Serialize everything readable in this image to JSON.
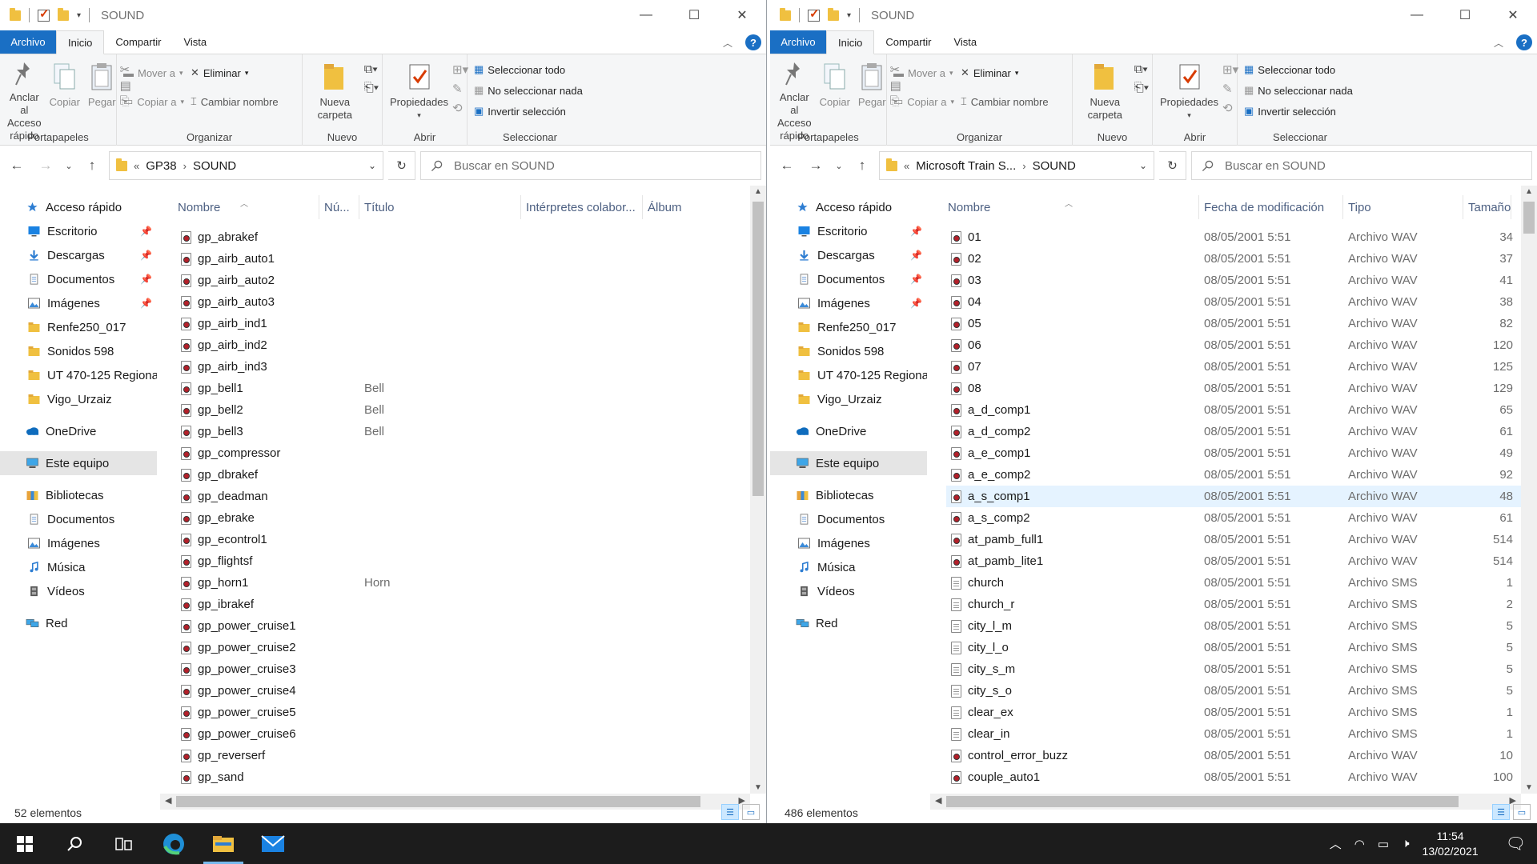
{
  "windows": [
    {
      "title": "SOUND",
      "tabs": {
        "file": "Archivo",
        "home": "Inicio",
        "share": "Compartir",
        "view": "Vista"
      },
      "ribbon": {
        "pin": "Anclar al Acceso rápido",
        "copy": "Copiar",
        "paste": "Pegar",
        "clipboard_group": "Portapapeles",
        "move_to": "Mover a",
        "copy_to": "Copiar a",
        "delete": "Eliminar",
        "rename": "Cambiar nombre",
        "organize_group": "Organizar",
        "new_folder": "Nueva carpeta",
        "new_group": "Nuevo",
        "properties": "Propiedades",
        "open_group": "Abrir",
        "select_all": "Seleccionar todo",
        "select_none": "No seleccionar nada",
        "invert": "Invertir selección",
        "select_group": "Seleccionar"
      },
      "path": [
        "GP38",
        "SOUND"
      ],
      "search_placeholder": "Buscar en SOUND",
      "nav": [
        {
          "label": "Acceso rápido",
          "icon": "star-icon",
          "top": true
        },
        {
          "label": "Escritorio",
          "icon": "desktop-icon",
          "pin": true
        },
        {
          "label": "Descargas",
          "icon": "download-icon",
          "pin": true
        },
        {
          "label": "Documentos",
          "icon": "document-icon",
          "pin": true
        },
        {
          "label": "Imágenes",
          "icon": "pictures-icon",
          "pin": true
        },
        {
          "label": "Renfe250_017",
          "icon": "folder-icon"
        },
        {
          "label": "Sonidos 598",
          "icon": "folder-icon"
        },
        {
          "label": "UT 470-125 Regional",
          "icon": "folder-icon"
        },
        {
          "label": "Vigo_Urzaiz",
          "icon": "folder-icon"
        },
        {
          "label": "OneDrive",
          "icon": "cloud-icon",
          "top": true,
          "gap": true
        },
        {
          "label": "Este equipo",
          "icon": "computer-icon",
          "top": true,
          "gap": true,
          "sel": true
        },
        {
          "label": "Bibliotecas",
          "icon": "libraries-icon",
          "top": true,
          "gap": true
        },
        {
          "label": "Documentos",
          "icon": "document-icon"
        },
        {
          "label": "Imágenes",
          "icon": "pictures-icon"
        },
        {
          "label": "Música",
          "icon": "music-icon"
        },
        {
          "label": "Vídeos",
          "icon": "video-icon"
        },
        {
          "label": "Red",
          "icon": "network-icon",
          "top": true,
          "gap": true
        }
      ],
      "columns": [
        "Nombre",
        "Nú...",
        "Título",
        "Intérpretes colabor...",
        "Álbum"
      ],
      "files": [
        {
          "name": "gp_abrakef",
          "title": ""
        },
        {
          "name": "gp_airb_auto1",
          "title": ""
        },
        {
          "name": "gp_airb_auto2",
          "title": ""
        },
        {
          "name": "gp_airb_auto3",
          "title": ""
        },
        {
          "name": "gp_airb_ind1",
          "title": ""
        },
        {
          "name": "gp_airb_ind2",
          "title": ""
        },
        {
          "name": "gp_airb_ind3",
          "title": ""
        },
        {
          "name": "gp_bell1",
          "title": "Bell"
        },
        {
          "name": "gp_bell2",
          "title": "Bell"
        },
        {
          "name": "gp_bell3",
          "title": "Bell"
        },
        {
          "name": "gp_compressor",
          "title": ""
        },
        {
          "name": "gp_dbrakef",
          "title": ""
        },
        {
          "name": "gp_deadman",
          "title": ""
        },
        {
          "name": "gp_ebrake",
          "title": ""
        },
        {
          "name": "gp_econtrol1",
          "title": ""
        },
        {
          "name": "gp_flightsf",
          "title": ""
        },
        {
          "name": "gp_horn1",
          "title": "Horn"
        },
        {
          "name": "gp_ibrakef",
          "title": ""
        },
        {
          "name": "gp_power_cruise1",
          "title": ""
        },
        {
          "name": "gp_power_cruise2",
          "title": ""
        },
        {
          "name": "gp_power_cruise3",
          "title": ""
        },
        {
          "name": "gp_power_cruise4",
          "title": ""
        },
        {
          "name": "gp_power_cruise5",
          "title": ""
        },
        {
          "name": "gp_power_cruise6",
          "title": ""
        },
        {
          "name": "gp_reverserf",
          "title": ""
        },
        {
          "name": "gp_sand",
          "title": ""
        }
      ],
      "status": "52 elementos"
    },
    {
      "title": "SOUND",
      "tabs": {
        "file": "Archivo",
        "home": "Inicio",
        "share": "Compartir",
        "view": "Vista"
      },
      "ribbon": {
        "pin": "Anclar al Acceso rápido",
        "copy": "Copiar",
        "paste": "Pegar",
        "clipboard_group": "Portapapeles",
        "move_to": "Mover a",
        "copy_to": "Copiar a",
        "delete": "Eliminar",
        "rename": "Cambiar nombre",
        "organize_group": "Organizar",
        "new_folder": "Nueva carpeta",
        "new_group": "Nuevo",
        "properties": "Propiedades",
        "open_group": "Abrir",
        "select_all": "Seleccionar todo",
        "select_none": "No seleccionar nada",
        "invert": "Invertir selección",
        "select_group": "Seleccionar"
      },
      "path": [
        "Microsoft Train S...",
        "SOUND"
      ],
      "search_placeholder": "Buscar en SOUND",
      "nav": [
        {
          "label": "Acceso rápido",
          "icon": "star-icon",
          "top": true
        },
        {
          "label": "Escritorio",
          "icon": "desktop-icon",
          "pin": true
        },
        {
          "label": "Descargas",
          "icon": "download-icon",
          "pin": true
        },
        {
          "label": "Documentos",
          "icon": "document-icon",
          "pin": true
        },
        {
          "label": "Imágenes",
          "icon": "pictures-icon",
          "pin": true
        },
        {
          "label": "Renfe250_017",
          "icon": "folder-icon"
        },
        {
          "label": "Sonidos 598",
          "icon": "folder-icon"
        },
        {
          "label": "UT 470-125 Regional",
          "icon": "folder-icon"
        },
        {
          "label": "Vigo_Urzaiz",
          "icon": "folder-icon"
        },
        {
          "label": "OneDrive",
          "icon": "cloud-icon",
          "top": true,
          "gap": true
        },
        {
          "label": "Este equipo",
          "icon": "computer-icon",
          "top": true,
          "gap": true,
          "sel": true
        },
        {
          "label": "Bibliotecas",
          "icon": "libraries-icon",
          "top": true,
          "gap": true
        },
        {
          "label": "Documentos",
          "icon": "document-icon"
        },
        {
          "label": "Imágenes",
          "icon": "pictures-icon"
        },
        {
          "label": "Música",
          "icon": "music-icon"
        },
        {
          "label": "Vídeos",
          "icon": "video-icon"
        },
        {
          "label": "Red",
          "icon": "network-icon",
          "top": true,
          "gap": true
        }
      ],
      "columns": [
        "Nombre",
        "Fecha de modificación",
        "Tipo",
        "Tamaño"
      ],
      "files": [
        {
          "name": "01",
          "date": "08/05/2001 5:51",
          "type": "Archivo WAV",
          "size": "34",
          "kind": "wav"
        },
        {
          "name": "02",
          "date": "08/05/2001 5:51",
          "type": "Archivo WAV",
          "size": "37",
          "kind": "wav"
        },
        {
          "name": "03",
          "date": "08/05/2001 5:51",
          "type": "Archivo WAV",
          "size": "41",
          "kind": "wav"
        },
        {
          "name": "04",
          "date": "08/05/2001 5:51",
          "type": "Archivo WAV",
          "size": "38",
          "kind": "wav"
        },
        {
          "name": "05",
          "date": "08/05/2001 5:51",
          "type": "Archivo WAV",
          "size": "82",
          "kind": "wav"
        },
        {
          "name": "06",
          "date": "08/05/2001 5:51",
          "type": "Archivo WAV",
          "size": "120",
          "kind": "wav"
        },
        {
          "name": "07",
          "date": "08/05/2001 5:51",
          "type": "Archivo WAV",
          "size": "125",
          "kind": "wav"
        },
        {
          "name": "08",
          "date": "08/05/2001 5:51",
          "type": "Archivo WAV",
          "size": "129",
          "kind": "wav"
        },
        {
          "name": "a_d_comp1",
          "date": "08/05/2001 5:51",
          "type": "Archivo WAV",
          "size": "65",
          "kind": "wav"
        },
        {
          "name": "a_d_comp2",
          "date": "08/05/2001 5:51",
          "type": "Archivo WAV",
          "size": "61",
          "kind": "wav"
        },
        {
          "name": "a_e_comp1",
          "date": "08/05/2001 5:51",
          "type": "Archivo WAV",
          "size": "49",
          "kind": "wav"
        },
        {
          "name": "a_e_comp2",
          "date": "08/05/2001 5:51",
          "type": "Archivo WAV",
          "size": "92",
          "kind": "wav"
        },
        {
          "name": "a_s_comp1",
          "date": "08/05/2001 5:51",
          "type": "Archivo WAV",
          "size": "48",
          "kind": "wav",
          "hl": true
        },
        {
          "name": "a_s_comp2",
          "date": "08/05/2001 5:51",
          "type": "Archivo WAV",
          "size": "61",
          "kind": "wav"
        },
        {
          "name": "at_pamb_full1",
          "date": "08/05/2001 5:51",
          "type": "Archivo WAV",
          "size": "514",
          "kind": "wav"
        },
        {
          "name": "at_pamb_lite1",
          "date": "08/05/2001 5:51",
          "type": "Archivo WAV",
          "size": "514",
          "kind": "wav"
        },
        {
          "name": "church",
          "date": "08/05/2001 5:51",
          "type": "Archivo SMS",
          "size": "1",
          "kind": "sms"
        },
        {
          "name": "church_r",
          "date": "08/05/2001 5:51",
          "type": "Archivo SMS",
          "size": "2",
          "kind": "sms"
        },
        {
          "name": "city_l_m",
          "date": "08/05/2001 5:51",
          "type": "Archivo SMS",
          "size": "5",
          "kind": "sms"
        },
        {
          "name": "city_l_o",
          "date": "08/05/2001 5:51",
          "type": "Archivo SMS",
          "size": "5",
          "kind": "sms"
        },
        {
          "name": "city_s_m",
          "date": "08/05/2001 5:51",
          "type": "Archivo SMS",
          "size": "5",
          "kind": "sms"
        },
        {
          "name": "city_s_o",
          "date": "08/05/2001 5:51",
          "type": "Archivo SMS",
          "size": "5",
          "kind": "sms"
        },
        {
          "name": "clear_ex",
          "date": "08/05/2001 5:51",
          "type": "Archivo SMS",
          "size": "1",
          "kind": "sms"
        },
        {
          "name": "clear_in",
          "date": "08/05/2001 5:51",
          "type": "Archivo SMS",
          "size": "1",
          "kind": "sms"
        },
        {
          "name": "control_error_buzz",
          "date": "08/05/2001 5:51",
          "type": "Archivo WAV",
          "size": "10",
          "kind": "wav"
        },
        {
          "name": "couple_auto1",
          "date": "08/05/2001 5:51",
          "type": "Archivo WAV",
          "size": "100",
          "kind": "wav"
        }
      ],
      "status": "486 elementos"
    }
  ],
  "taskbar": {
    "time": "11:54",
    "date": "13/02/2021"
  },
  "colors": {
    "accent": "#1a6fc4",
    "selection": "#e5f3ff",
    "taskbar": "#1c1c1c"
  }
}
